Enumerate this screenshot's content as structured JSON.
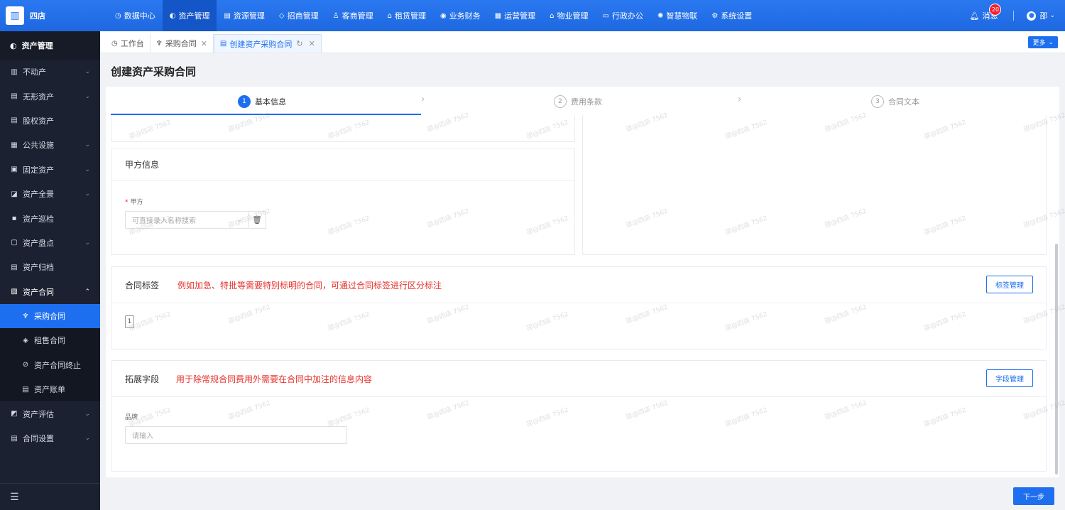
{
  "topbar": {
    "logo_glyph": "▥",
    "brand": "四店",
    "nav": [
      {
        "label": "数据中心",
        "icon": "◷",
        "active": false
      },
      {
        "label": "资产管理",
        "icon": "◐",
        "active": true
      },
      {
        "label": "资源管理",
        "icon": "▤",
        "active": false
      },
      {
        "label": "招商管理",
        "icon": "◇",
        "active": false
      },
      {
        "label": "客商管理",
        "icon": "♙",
        "active": false
      },
      {
        "label": "租赁管理",
        "icon": "⌂",
        "active": false
      },
      {
        "label": "业务财务",
        "icon": "◉",
        "active": false
      },
      {
        "label": "运营管理",
        "icon": "▦",
        "active": false
      },
      {
        "label": "物业管理",
        "icon": "⌂",
        "active": false
      },
      {
        "label": "行政办公",
        "icon": "▭",
        "active": false
      },
      {
        "label": "智慧物联",
        "icon": "✺",
        "active": false
      },
      {
        "label": "系统设置",
        "icon": "⚙",
        "active": false
      }
    ],
    "messages_label": "消息",
    "messages_count": "20",
    "user_initial": "邵",
    "user_caret": "⌄"
  },
  "sidebar": {
    "header": "资产管理",
    "items": [
      {
        "label": "不动产",
        "icon": "▥",
        "chev": "⌄"
      },
      {
        "label": "无形资产",
        "icon": "▤",
        "chev": "⌄"
      },
      {
        "label": "股权资产",
        "icon": "▤",
        "chev": ""
      },
      {
        "label": "公共设施",
        "icon": "▦",
        "chev": "⌄"
      },
      {
        "label": "固定资产",
        "icon": "▣",
        "chev": "⌄"
      },
      {
        "label": "资产全景",
        "icon": "◪",
        "chev": "⌄"
      },
      {
        "label": "资产巡检",
        "icon": "▪",
        "chev": ""
      },
      {
        "label": "资产盘点",
        "icon": "▢",
        "chev": "⌄"
      },
      {
        "label": "资产归档",
        "icon": "▤",
        "chev": ""
      },
      {
        "label": "资产合同",
        "icon": "▧",
        "chev": "⌃"
      }
    ],
    "sub_items": [
      {
        "label": "采购合同",
        "icon": "♆",
        "active": true
      },
      {
        "label": "租售合同",
        "icon": "◈",
        "active": false
      },
      {
        "label": "资产合同终止",
        "icon": "⊘",
        "active": false
      },
      {
        "label": "资产账单",
        "icon": "▤",
        "active": false
      }
    ],
    "items_after": [
      {
        "label": "资产评估",
        "icon": "◩",
        "chev": "⌄"
      },
      {
        "label": "合同设置",
        "icon": "▤",
        "chev": "⌄"
      }
    ],
    "collapse_glyph": "☰"
  },
  "tabs": [
    {
      "label": "工作台",
      "icon": "◷",
      "close": "",
      "active": false
    },
    {
      "label": "采购合同",
      "icon": "♆",
      "close": "✕",
      "active": false
    },
    {
      "label": "创建资产采购合同",
      "icon": "▤",
      "close": "✕",
      "refresh": "↻",
      "active": true
    }
  ],
  "more_button": "更多",
  "more_caret": "⌄",
  "page_title": "创建资产采购合同",
  "steps": [
    {
      "num": "1",
      "label": "基本信息"
    },
    {
      "num": "2",
      "label": "费用条款"
    },
    {
      "num": "3",
      "label": "合同文本"
    }
  ],
  "step_arrow": "›",
  "party_a": {
    "title": "甲方信息",
    "field_label": "甲方",
    "required_mark": "*",
    "placeholder": "可直接录入名称搜索",
    "select_caret": "⌄",
    "delete_glyph": "🗑"
  },
  "contract_tags": {
    "title": "合同标签",
    "hint": "例如加急、特批等需要特别标明的合同，可通过合同标签进行区分标注",
    "manage_button": "标签管理",
    "tag_value": "1"
  },
  "ext_fields": {
    "title": "拓展字段",
    "hint": "用于除常规合同费用外需要在合同中加注的信息内容",
    "manage_button": "字段管理",
    "brand_label": "品牌",
    "brand_placeholder": "请输入"
  },
  "next_button": "下一步",
  "watermark": "邵@四店 7562"
}
